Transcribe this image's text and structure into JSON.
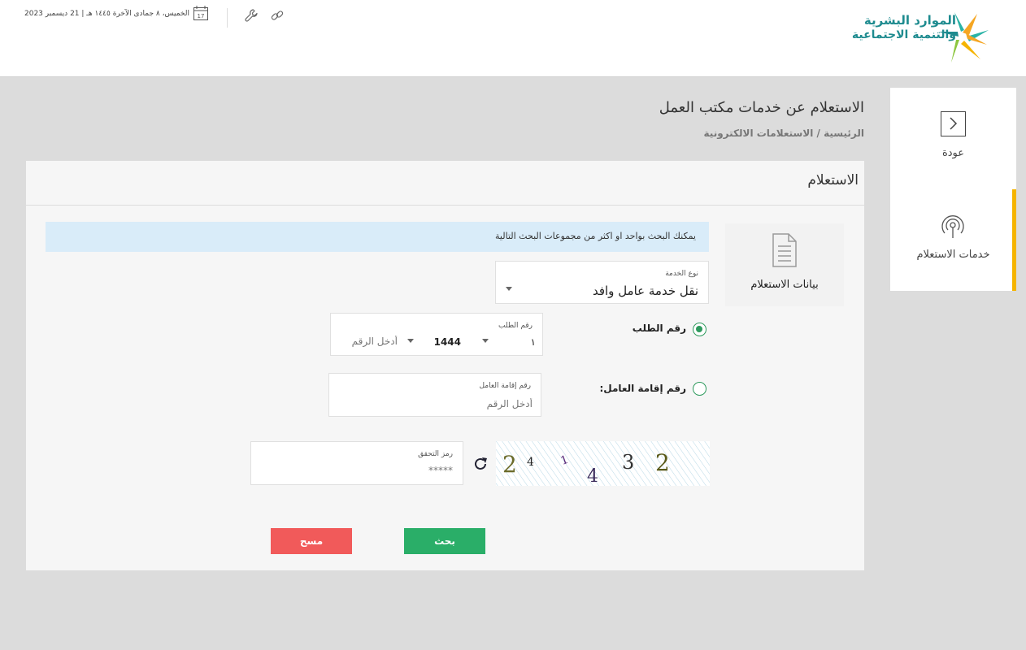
{
  "header": {
    "logo_line1": "الموارد البشرية",
    "logo_line2": "والتنمية الاجتماعية",
    "date": "الخميس، ٨ جمادى الآخرة ١٤٤٥ هـ | 21 ديسمبر 2023",
    "calendar_day": "17",
    "icons": [
      "calendar-icon",
      "wrench-icon",
      "link-icon"
    ]
  },
  "page": {
    "title": "الاستعلام عن خدمات مكتب العمل",
    "breadcrumb": "الرئيسية / الاستعلامات الالكترونية"
  },
  "sidebar": {
    "items": [
      {
        "label": "عودة",
        "icon": "chevron-right-icon"
      },
      {
        "label": "خدمات الاستعلام",
        "icon": "signal-icon",
        "active": true
      }
    ],
    "accent_color": "#f5b400"
  },
  "card": {
    "title": "الاستعلام",
    "section_label": "بيانات الاستعلام",
    "info_message": "يمكنك البحث بواحد او اكثر من مجموعات البحث التالية",
    "service_type": {
      "label": "نوع الخدمة",
      "value": "نقل خدمة عامل وافد"
    },
    "request_number": {
      "radio_label": "رقم الطلب",
      "selected": true,
      "field_label": "رقم الطلب",
      "prefix_value": "١",
      "year_value": "1444",
      "placeholder": "أدخل الرقم"
    },
    "iqama_number": {
      "radio_label": "رقم إقامة العامل:",
      "selected": false,
      "field_label": "رقم إقامة العامل",
      "placeholder": "أدخل الرقم"
    },
    "captcha": {
      "field_label": "رمز التحقق",
      "value": "*****",
      "chars": [
        "2",
        "4",
        "1",
        "4",
        "3",
        "2"
      ]
    },
    "buttons": {
      "search": "بحث",
      "clear": "مسح"
    }
  },
  "colors": {
    "primary_green": "#2aae68",
    "danger_red": "#f15a5a",
    "info_bg": "#d9ecf9",
    "brand_teal": "#1e8b8f"
  }
}
